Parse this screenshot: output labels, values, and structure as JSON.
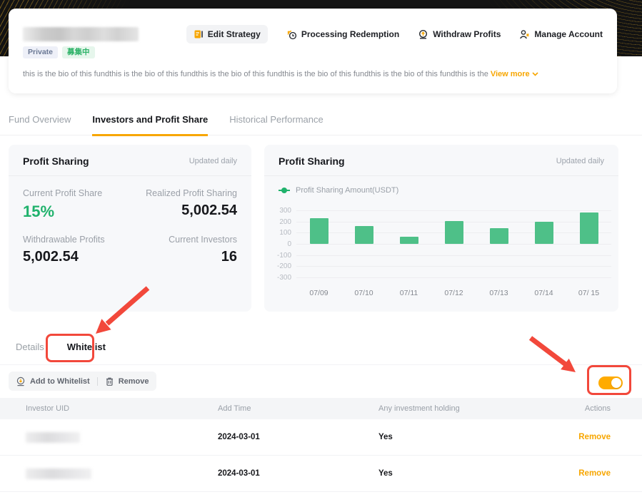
{
  "colors": {
    "accent_orange": "#f7a600",
    "green": "#20b26c",
    "bar_green": "#4ec088",
    "annotation_red": "#f2483b",
    "toggle_on": "#ffab00",
    "dark_band": "#131313"
  },
  "hero": {
    "fund_name_blurred": true,
    "badges": [
      {
        "label": "Private"
      },
      {
        "label": "募集中"
      }
    ],
    "bio": "this is the bio of this fundthis is the bio of this fundthis is the bio of this fundthis is the bio of this fundthis is the bio of this fundthis is the",
    "view_more": "View more",
    "actions": [
      {
        "label": "Edit Strategy",
        "icon": "edit-strategy-icon"
      },
      {
        "label": "Processing Redemption",
        "icon": "processing-redemption-icon"
      },
      {
        "label": "Withdraw Profits",
        "icon": "withdraw-profits-icon"
      },
      {
        "label": "Manage Account",
        "icon": "manage-account-icon"
      }
    ]
  },
  "tabs": [
    {
      "label": "Fund Overview",
      "active": false
    },
    {
      "label": "Investors and Profit Share",
      "active": true
    },
    {
      "label": "Historical Performance",
      "active": false
    }
  ],
  "profit_summary": {
    "title": "Profit Sharing",
    "updated": "Updated daily",
    "stats": [
      {
        "label": "Current Profit Share",
        "value": "15%",
        "highlight": "green"
      },
      {
        "label": "Realized Profit Sharing",
        "value": "5,002.54"
      },
      {
        "label": "Withdrawable Profits",
        "value": "5,002.54"
      },
      {
        "label": "Current Investors",
        "value": "16"
      }
    ]
  },
  "chart_panel": {
    "title": "Profit Sharing",
    "updated": "Updated daily",
    "legend": "Profit Sharing Amount(USDT)"
  },
  "chart_data": {
    "type": "bar",
    "title": "Profit Sharing",
    "series": [
      {
        "name": "Profit Sharing Amount(USDT)",
        "values": [
          230,
          160,
          65,
          205,
          140,
          195,
          280
        ]
      }
    ],
    "categories": [
      "07/09",
      "07/10",
      "07/11",
      "07/12",
      "07/13",
      "07/14",
      "07/ 15"
    ],
    "yticks": [
      300,
      200,
      100,
      0,
      -100,
      -200,
      -300
    ],
    "ylim": [
      -300,
      300
    ],
    "grid": true,
    "legend_position": "top-left",
    "bar_color": "#4ec088"
  },
  "section_tabs": [
    {
      "label": "Details",
      "active": false
    },
    {
      "label": "Whitelist",
      "active": true
    }
  ],
  "toolbar": {
    "add_label": "Add to Whitelist",
    "remove_label": "Remove"
  },
  "whitelist_toggle": {
    "state": "on"
  },
  "table": {
    "columns": [
      "Investor UID",
      "Add Time",
      "Any investment holding",
      "Actions"
    ],
    "rows": [
      {
        "uid_blurred": true,
        "add_time": "2024-03-01",
        "holding": "Yes",
        "action": "Remove"
      },
      {
        "uid_blurred": true,
        "add_time": "2024-03-01",
        "holding": "Yes",
        "action": "Remove"
      }
    ]
  }
}
